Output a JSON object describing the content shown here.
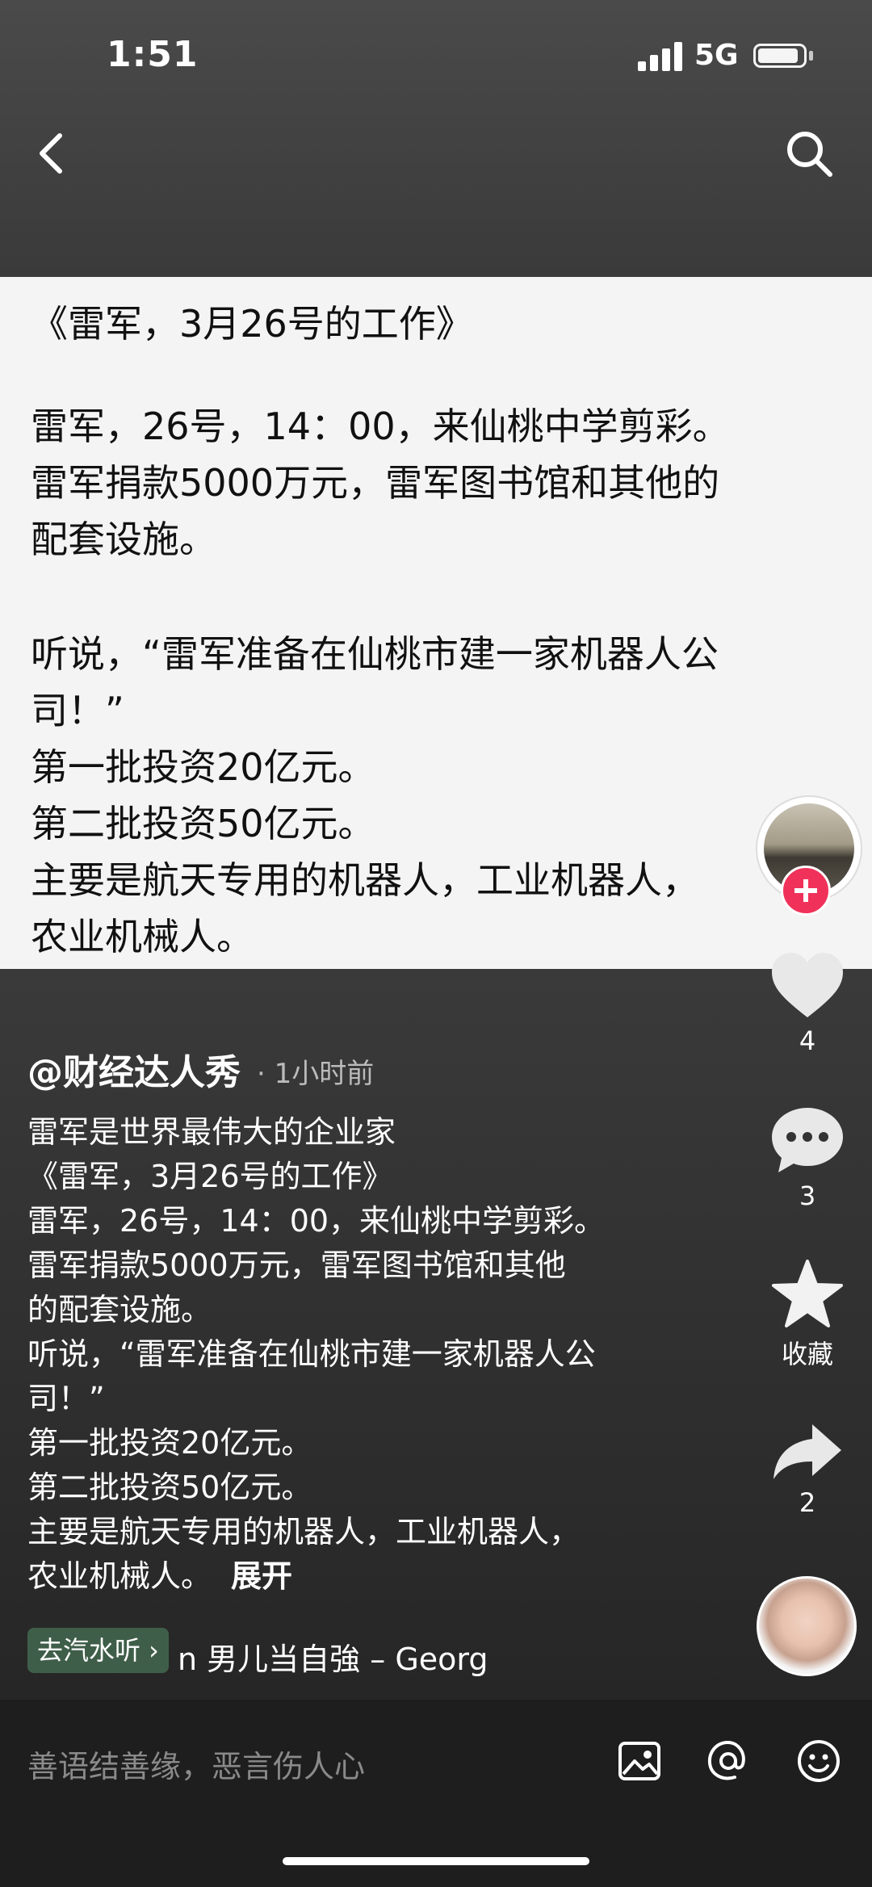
{
  "status": {
    "time": "1:51",
    "network": "5G"
  },
  "content": {
    "title": "《雷军，3月26号的工作》",
    "lines": [
      "雷军，26号，14：00，来仙桃中学剪彩。",
      "雷军捐款5000万元，雷军图书馆和其他的",
      "配套设施。",
      "听说，“雷军准备在仙桃市建一家机器人公",
      "司！”",
      "第一批投资20亿元。",
      "第二批投资50亿元。",
      "主要是航天专用的机器人，工业机器人，",
      "农业机械人。"
    ]
  },
  "actions": {
    "like_count": "4",
    "comment_count": "3",
    "favorite_label": "收藏",
    "share_count": "2"
  },
  "post": {
    "author": "@财经达人秀",
    "time_ago": "· 1小时前",
    "caption_lines": [
      "雷军是世界最伟大的企业家",
      "《雷军，3月26号的工作》",
      "雷军，26号，14：00，来仙桃中学剪彩。",
      "雷军捐款5000万元，雷军图书馆和其他",
      "的配套设施。",
      "听说，“雷军准备在仙桃市建一家机器人公",
      "司！”",
      "第一批投资20亿元。",
      "第二批投资50亿元。",
      "主要是航天专用的机器人，工业机器人，"
    ],
    "last_line": "农业机械人。",
    "expand_label": "展开"
  },
  "music": {
    "goto_label": "去汽水听 ›",
    "track_text": "n    男儿当自強 – Georg"
  },
  "comment_bar": {
    "placeholder": "善语结善缘，恶言伤人心"
  }
}
